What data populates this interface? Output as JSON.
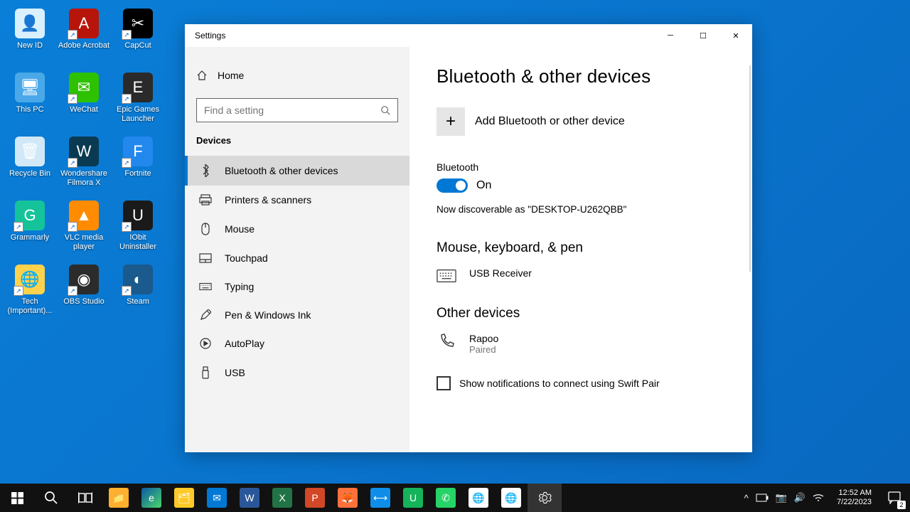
{
  "desktop_icons": [
    {
      "label": "New ID",
      "color": "#d9f0ff",
      "glyph": "👤"
    },
    {
      "label": "Adobe Acrobat",
      "color": "#b8150a",
      "glyph": "A",
      "sc": true
    },
    {
      "label": "CapCut",
      "color": "#000",
      "glyph": "✂",
      "sc": true
    },
    {
      "label": "This PC",
      "color": "#4aa8e8",
      "glyph": "🖥"
    },
    {
      "label": "WeChat",
      "color": "#2dc100",
      "glyph": "✉",
      "sc": true
    },
    {
      "label": "Epic Games Launcher",
      "color": "#2a2a2a",
      "glyph": "E",
      "sc": true
    },
    {
      "label": "Recycle Bin",
      "color": "#d0e8f7",
      "glyph": "🗑"
    },
    {
      "label": "Wondershare Filmora X",
      "color": "#0a3a52",
      "glyph": "W",
      "sc": true
    },
    {
      "label": "Fortnite",
      "color": "#2288ee",
      "glyph": "F",
      "sc": true
    },
    {
      "label": "Grammarly",
      "color": "#15c39a",
      "glyph": "G",
      "sc": true
    },
    {
      "label": "VLC media player",
      "color": "#ff8c00",
      "glyph": "▲",
      "sc": true
    },
    {
      "label": "IObit Uninstaller",
      "color": "#1a1a1a",
      "glyph": "U",
      "sc": true
    },
    {
      "label": "Tech (Important)...",
      "color": "#ffd24d",
      "glyph": "🌐",
      "sc": true
    },
    {
      "label": "OBS Studio",
      "color": "#2b2b2b",
      "glyph": "◉",
      "sc": true
    },
    {
      "label": "Steam",
      "color": "#1a5a8c",
      "glyph": "◐",
      "sc": true
    }
  ],
  "window": {
    "title": "Settings",
    "home": "Home",
    "search_placeholder": "Find a setting",
    "category": "Devices",
    "nav": [
      {
        "label": "Bluetooth & other devices",
        "icon": "bt",
        "active": true
      },
      {
        "label": "Printers & scanners",
        "icon": "printer"
      },
      {
        "label": "Mouse",
        "icon": "mouse"
      },
      {
        "label": "Touchpad",
        "icon": "touchpad"
      },
      {
        "label": "Typing",
        "icon": "keyboard"
      },
      {
        "label": "Pen & Windows Ink",
        "icon": "pen"
      },
      {
        "label": "AutoPlay",
        "icon": "autoplay"
      },
      {
        "label": "USB",
        "icon": "usb"
      }
    ],
    "main": {
      "heading": "Bluetooth & other devices",
      "add_label": "Add Bluetooth or other device",
      "bt_label": "Bluetooth",
      "bt_state": "On",
      "discoverable": "Now discoverable as \"DESKTOP-U262QBB\"",
      "section_mkp": "Mouse, keyboard, & pen",
      "dev1": {
        "name": "USB Receiver"
      },
      "section_other": "Other devices",
      "dev2": {
        "name": "Rapoo",
        "status": "Paired"
      },
      "swift_pair": "Show notifications to connect using Swift Pair"
    }
  },
  "taskbar": {
    "time": "12:52 AM",
    "date": "7/22/2023",
    "notif_count": "2"
  }
}
